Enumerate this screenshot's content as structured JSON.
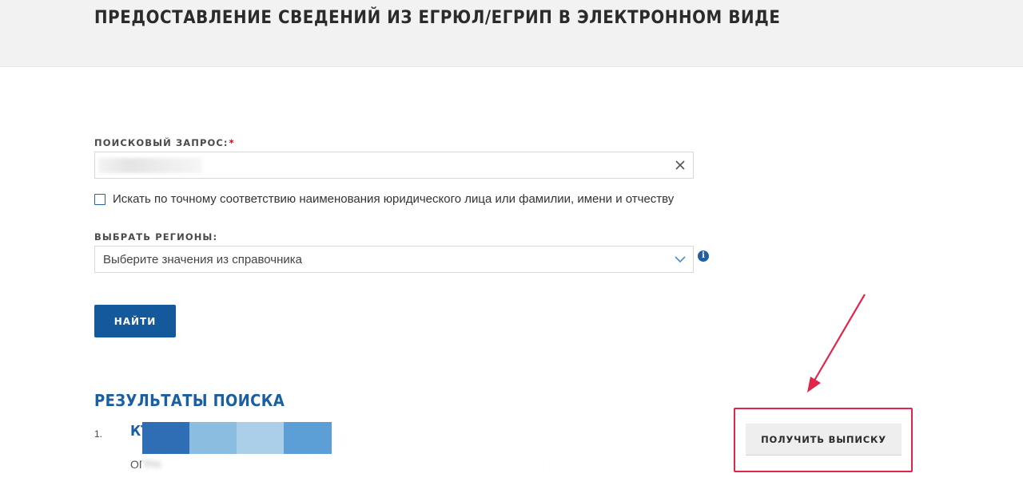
{
  "page": {
    "title": "ПРЕДОСТАВЛЕНИЕ СВЕДЕНИЙ ИЗ ЕГРЮЛ/ЕГРИП В ЭЛЕКТРОННОМ ВИДЕ"
  },
  "search": {
    "label": "ПОИСКОВЫЙ ЗАПРОС:",
    "required_mark": "*",
    "value_redacted": true,
    "clear_icon": "close-icon"
  },
  "exact_match": {
    "checked": false,
    "label": "Искать по точному соответствию наименования юридического лица или фамилии, имени и отчеству"
  },
  "regions": {
    "label": "ВЫБРАТЬ РЕГИОНЫ:",
    "placeholder": "Выберите значения из справочника",
    "dropdown_icon": "chevron-down-icon",
    "info_icon": "info-icon"
  },
  "actions": {
    "find_label": "НАЙТИ"
  },
  "results": {
    "heading": "РЕЗУЛЬТАТЫ ПОИСКА",
    "items": [
      {
        "number": "1.",
        "name_visible": "КТ",
        "meta_visible": "ОГРН",
        "extract_button_label": "ПОЛУЧИТЬ ВЫПИСКУ"
      }
    ]
  },
  "colors": {
    "header_band": "#f2f2f2",
    "primary_blue": "#14599c",
    "heading_blue": "#1a5fa0",
    "annotation_red": "#e0244a",
    "secondary_button": "#eeeeee"
  }
}
